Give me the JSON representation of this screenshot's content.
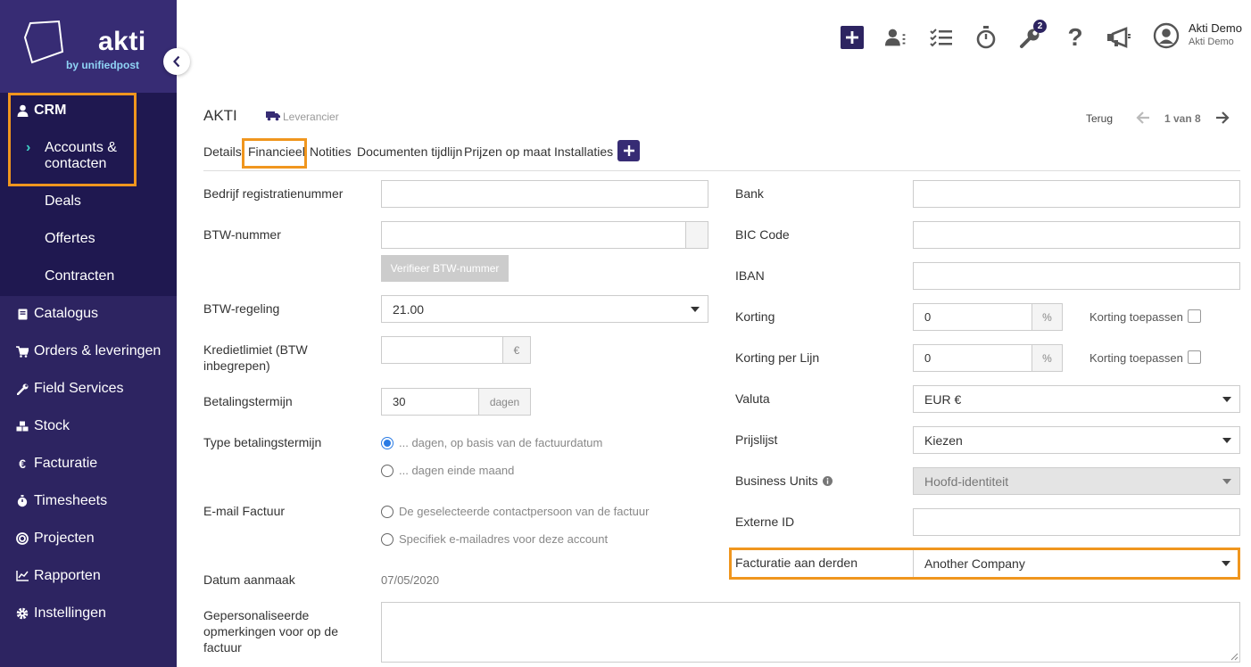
{
  "brand": {
    "name": "akti",
    "tagline": "by unifiedpost"
  },
  "sidebar": {
    "crm": "CRM",
    "crm_items": [
      "Accounts & contacten",
      "Deals",
      "Offertes",
      "Contracten"
    ],
    "items": [
      {
        "label": "Catalogus",
        "icon": "book-icon"
      },
      {
        "label": "Orders & leveringen",
        "icon": "cart-icon"
      },
      {
        "label": "Field Services",
        "icon": "wrench-icon"
      },
      {
        "label": "Stock",
        "icon": "boxes-icon"
      },
      {
        "label": "Facturatie",
        "icon": "euro-icon"
      },
      {
        "label": "Timesheets",
        "icon": "stopwatch-icon"
      },
      {
        "label": "Projecten",
        "icon": "target-icon"
      },
      {
        "label": "Rapporten",
        "icon": "chart-icon"
      },
      {
        "label": "Instellingen",
        "icon": "gear-icon"
      }
    ]
  },
  "topbar": {
    "notification_count": "2",
    "user_name": "Akti Demo",
    "user_company": "Akti Demo"
  },
  "account": {
    "title": "AKTI",
    "type": "Leverancier",
    "back": "Terug",
    "pager": "1 van 8"
  },
  "tabs": [
    "Details",
    "Financieel",
    "Notities",
    "Documenten tijdlijn",
    "Prijzen op maat",
    "Installaties"
  ],
  "left": {
    "reg_label": "Bedrijf registratienummer",
    "reg_value": "",
    "vat_label": "BTW-nummer",
    "vat_value": "",
    "verify_button": "Verifieer BTW-nummer",
    "vat_regime_label": "BTW-regeling",
    "vat_regime_value": "21.00",
    "credit_label": "Kredietlimiet (BTW inbegrepen)",
    "credit_value": "",
    "credit_unit": "€",
    "term_label": "Betalingstermijn",
    "term_value": "30",
    "term_unit": "dagen",
    "term_type_label": "Type betalingstermijn",
    "term_type_options": [
      "... dagen, op basis van de factuurdatum",
      "... dagen einde maand"
    ],
    "term_type_selected": 0,
    "email_label": "E-mail Factuur",
    "email_options": [
      "De geselecteerde contactpersoon van de factuur",
      "Specifiek e-mailadres voor deze account"
    ],
    "created_label": "Datum aanmaak",
    "created_value": "07/05/2020",
    "remarks_label": "Gepersonaliseerde opmerkingen voor op de factuur",
    "remarks_value": ""
  },
  "right": {
    "bank_label": "Bank",
    "bank_value": "",
    "bic_label": "BIC Code",
    "bic_value": "",
    "iban_label": "IBAN",
    "iban_value": "",
    "discount_label": "Korting",
    "discount_value": "0",
    "discount_unit": "%",
    "discount_apply": "Korting toepassen",
    "line_discount_label": "Korting per Lijn",
    "line_discount_value": "0",
    "line_discount_unit": "%",
    "line_discount_apply": "Korting toepassen",
    "currency_label": "Valuta",
    "currency_value": "EUR €",
    "pricelist_label": "Prijslijst",
    "pricelist_value": "Kiezen",
    "bu_label": "Business Units",
    "bu_value": "Hoofd-identiteit",
    "external_label": "Externe ID",
    "external_value": "",
    "third_party_label": "Facturatie aan derden",
    "third_party_value": "Another Company"
  },
  "colors": {
    "sidebar": "#2d2461",
    "accent": "#372c74",
    "highlight": "#f0961e",
    "radio": "#2a7be4"
  }
}
